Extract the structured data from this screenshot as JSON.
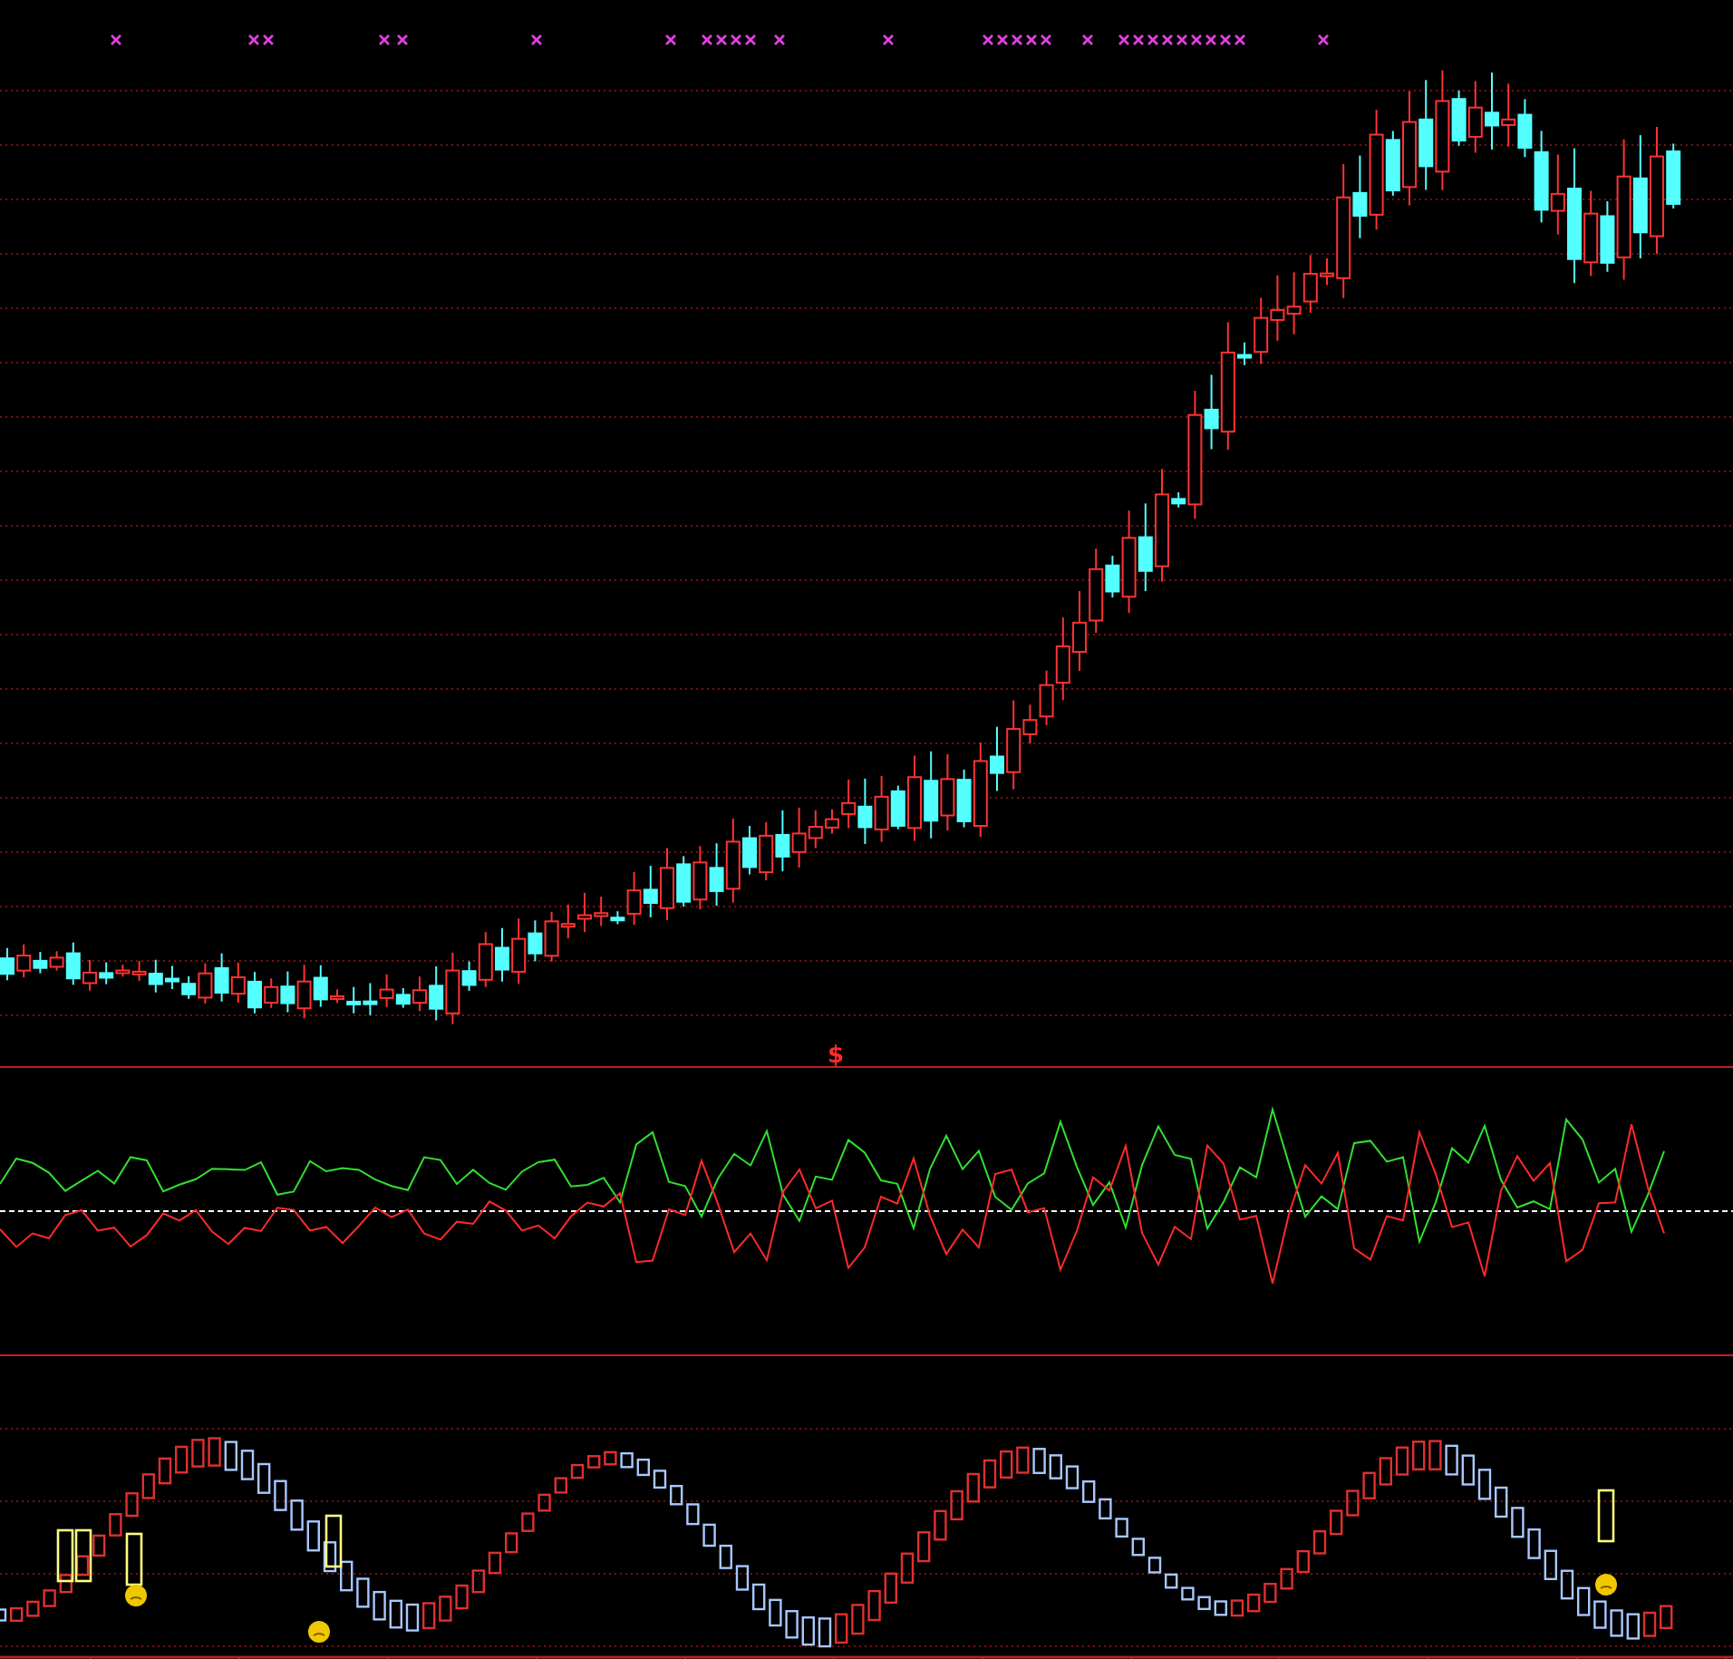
{
  "panels": [
    {
      "kind": "price"
    },
    {
      "kind": "oscillator"
    },
    {
      "kind": "signal"
    }
  ],
  "marker": {
    "text": "$"
  }
}
